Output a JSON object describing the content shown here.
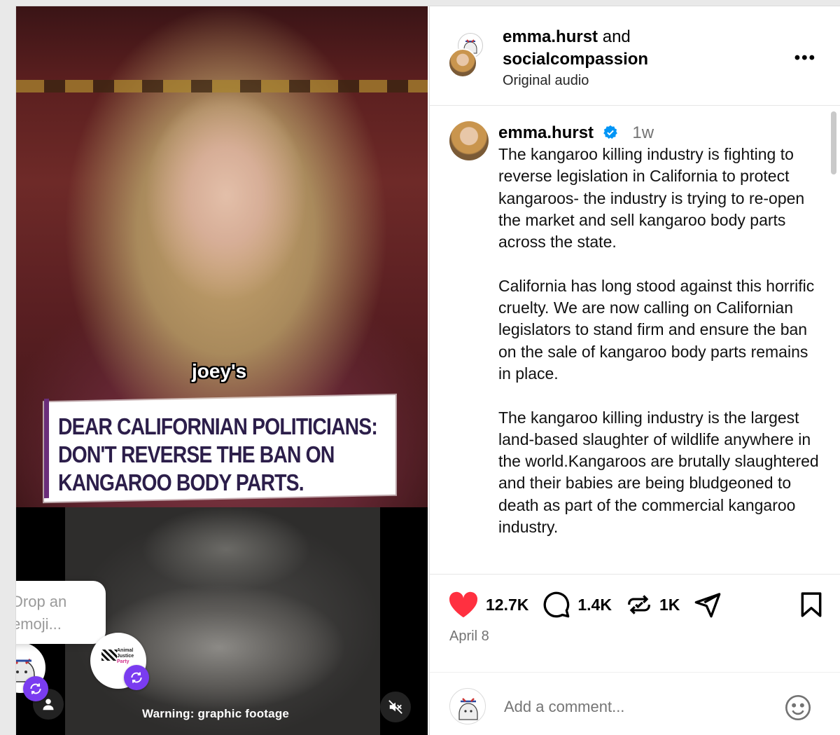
{
  "video": {
    "caption_word": "joey's",
    "banner_lines": [
      "DEAR CALIFORNIAN POLITICIANS:",
      "DON'T REVERSE THE BAN ON",
      "KANGAROO BODY PARTS."
    ],
    "warning_text": "Warning: graphic footage",
    "emoji_prompt": [
      "Drop an",
      "emoji..."
    ],
    "repost_logo_lines": [
      "Animal",
      "Justice",
      "Party"
    ],
    "icons": {
      "user": "person-icon",
      "mute": "speaker-muted-icon",
      "repost": "repost-icon"
    }
  },
  "header": {
    "author1": "emma.hurst",
    "connector": "and",
    "author2": "socialcompassion",
    "audio": "Original audio",
    "more": "•••"
  },
  "post": {
    "username": "emma.hurst",
    "time": "1w",
    "paragraphs": [
      "The kangaroo killing industry is fighting to reverse legislation in California to protect kangaroos- the industry is trying to re-open the market and sell kangaroo body parts across the state.",
      "California has long stood against this horrific cruelty. We are now calling on Californian legislators to stand firm and ensure the ban on the sale of kangaroo body parts remains in place.",
      "The kangaroo killing industry is the largest land-based slaughter of wildlife anywhere in the world.Kangaroos are brutally slaughtered and their babies are being bludgeoned to death as part of the commercial kangaroo industry."
    ]
  },
  "actions": {
    "likes": "12.7K",
    "comments": "1.4K",
    "reposts": "1K",
    "like_color": "#ff3040",
    "icons": [
      "heart-icon",
      "comment-icon",
      "repost-icon",
      "share-icon",
      "bookmark-icon"
    ]
  },
  "date": "April 8",
  "comment_box": {
    "placeholder": "Add a comment..."
  }
}
